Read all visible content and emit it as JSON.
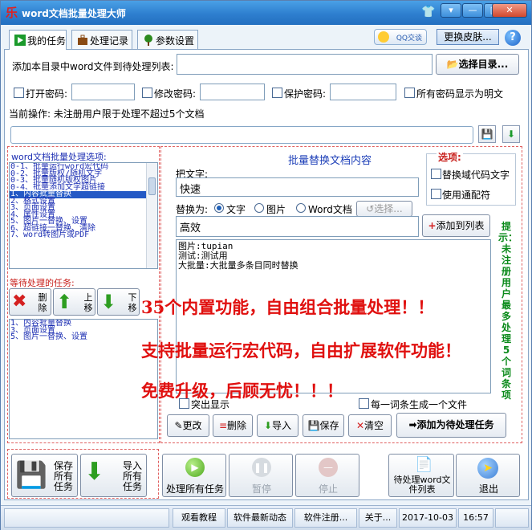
{
  "window": {
    "title": "word文档批量处理大师",
    "app_icon_glyph": "乐"
  },
  "tabs": [
    {
      "label": "我的任务",
      "icon": "play-icon",
      "active": true
    },
    {
      "label": "处理记录",
      "icon": "briefcase-icon",
      "active": false
    },
    {
      "label": "参数设置",
      "icon": "tree-icon",
      "active": false
    }
  ],
  "header": {
    "qq_label": "QQ交谈",
    "skin_label": "更换皮肤...",
    "help_glyph": "?"
  },
  "folder": {
    "label": "添加本目录中word文件到待处理列表:",
    "value": "",
    "select_btn": "选择目录..."
  },
  "passwords": {
    "open_label": "打开密码:",
    "modify_label": "修改密码:",
    "protect_label": "保护密码:",
    "show_label": "所有密码显示为明文"
  },
  "status": {
    "current_op": "当前操作: 未注册用户限于处理不超过5个文档",
    "progress": 0.0
  },
  "options": {
    "header": "word文档批量处理选项:",
    "items": [
      "0-1、批量运行word宏代码",
      "0-2、批量版权/随机文字",
      "0-3、批量随机版权图片",
      "0-4、批量添加文字超链接",
      "1、内容批量替换",
      "2、格式设置",
      "3、页面设置",
      "4、属性设置",
      "5、图片一替换、设置",
      "6、超链接一替换、清除",
      "7、word转图片或PDF"
    ],
    "selected_index": 4
  },
  "pending": {
    "header": "等待处理的任务:",
    "delete_label": "删除",
    "up_label": "上移",
    "down_label": "下移",
    "items": [
      "1、内容批量替换",
      "3、页面设置",
      "5、图片一替换、设置"
    ]
  },
  "replace": {
    "title": "批量替换文档内容",
    "from_label": "把文字:",
    "from_value": "快速",
    "to_label": "替换为:",
    "radio_text": "文字",
    "radio_image": "图片",
    "radio_doc": "Word文档",
    "choose_btn": "选择...",
    "to_value": "高效",
    "add_list_btn": "添加到列表",
    "list_items": [
      "图片:tupian",
      "测试:测试用",
      "大批量:大批量多条目同时替换"
    ],
    "options_title": "选项:",
    "opt_field_code": "替换域代码文字",
    "opt_wildcard": "使用通配符",
    "highlight_label": "突出显示",
    "each_file_label": "每一词条生成一个文件",
    "btn_edit": "更改",
    "btn_delete": "删除",
    "btn_import": "导入",
    "btn_save": "保存",
    "btn_clear": "清空",
    "btn_add_task": "添加为待处理任务"
  },
  "promo": [
    "35个内置功能，自由组合批量处理！！",
    "支持批量运行宏代码，自由扩展软件功能！",
    "免费升级，后顾无忧！！！"
  ],
  "hint_vertical": "提示：未注册用户最多处理5个词条项",
  "actions": {
    "save_all": "保存所有任务",
    "import_all": "导入所有任务",
    "process_all": "处理所有任务",
    "pause": "暂停",
    "stop": "停止",
    "pending_list": "待处理word文件列表",
    "exit": "退出"
  },
  "statusbar": {
    "tutorial": "观看教程",
    "news": "软件最新动态",
    "register": "软件注册...",
    "about": "关于...",
    "date": "2017-10-03",
    "time": "16:57"
  },
  "colors": {
    "title_bar": "#2e7fcf",
    "promo": "#e0100f",
    "hint": "#0a8a1a",
    "option_text": "#1d2fb3",
    "selection": "#2459c5"
  }
}
